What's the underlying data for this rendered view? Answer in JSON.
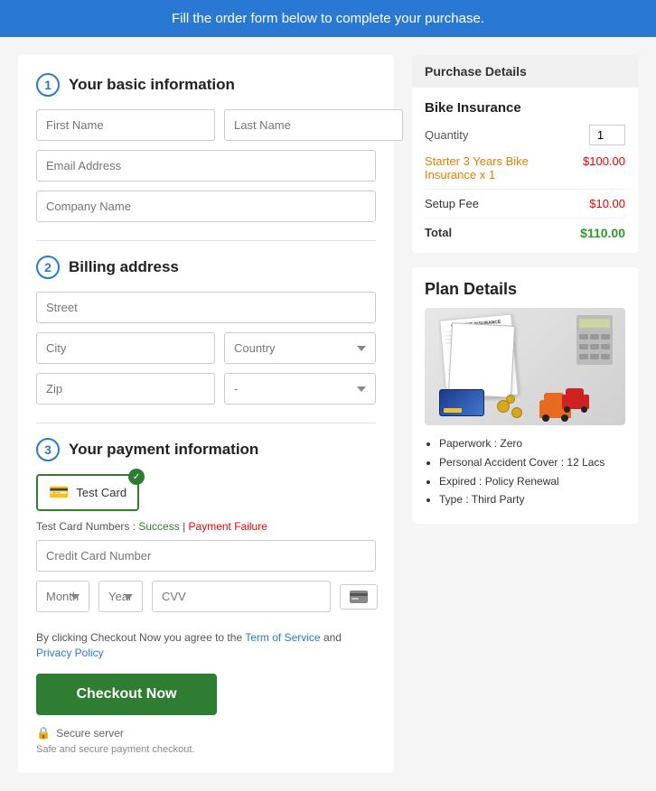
{
  "banner": {
    "text": "Fill the order form below to complete your purchase."
  },
  "form": {
    "section1": {
      "number": "1",
      "title": "Your basic information"
    },
    "section2": {
      "number": "2",
      "title": "Billing address"
    },
    "section3": {
      "number": "3",
      "title": "Your payment information"
    },
    "fields": {
      "firstName": {
        "placeholder": "First Name"
      },
      "lastName": {
        "placeholder": "Last Name"
      },
      "email": {
        "placeholder": "Email Address"
      },
      "companyName": {
        "placeholder": "Company Name"
      },
      "street": {
        "placeholder": "Street"
      },
      "city": {
        "placeholder": "City"
      },
      "country": {
        "placeholder": "Country"
      },
      "zip": {
        "placeholder": "Zip"
      },
      "state": {
        "placeholder": "-"
      },
      "creditCard": {
        "placeholder": "Credit Card Number"
      },
      "month": {
        "placeholder": "Month"
      },
      "year": {
        "placeholder": "Year"
      },
      "cvv": {
        "placeholder": "CVV"
      }
    },
    "card": {
      "label": "Test Card",
      "type": "Card"
    },
    "testCardInfo": {
      "prefix": "Test Card Numbers : ",
      "success": "Success",
      "separator": " | ",
      "failure": "Payment Failure"
    },
    "terms": {
      "prefix": "By clicking Checkout Now you agree to the ",
      "tos": "Term of Service",
      "conjunction": " and ",
      "privacy": "Privacy Policy"
    },
    "checkoutBtn": "Checkout Now",
    "secure": {
      "label": "Secure server",
      "safeText": "Safe and secure payment checkout."
    }
  },
  "purchaseDetails": {
    "header": "Purchase Details",
    "planName": "Bike Insurance",
    "quantity": {
      "label": "Quantity",
      "value": "1"
    },
    "item": {
      "name": "Starter 3 Years Bike Insurance x 1",
      "price": "$100.00"
    },
    "setupFee": {
      "label": "Setup Fee",
      "price": "$10.00"
    },
    "total": {
      "label": "Total",
      "price": "$110.00"
    }
  },
  "planDetails": {
    "title": "Plan Details",
    "features": [
      "Paperwork : Zero",
      "Personal Accident Cover : 12 Lacs",
      "Expired : Policy Renewal",
      "Type : Third Party"
    ]
  }
}
